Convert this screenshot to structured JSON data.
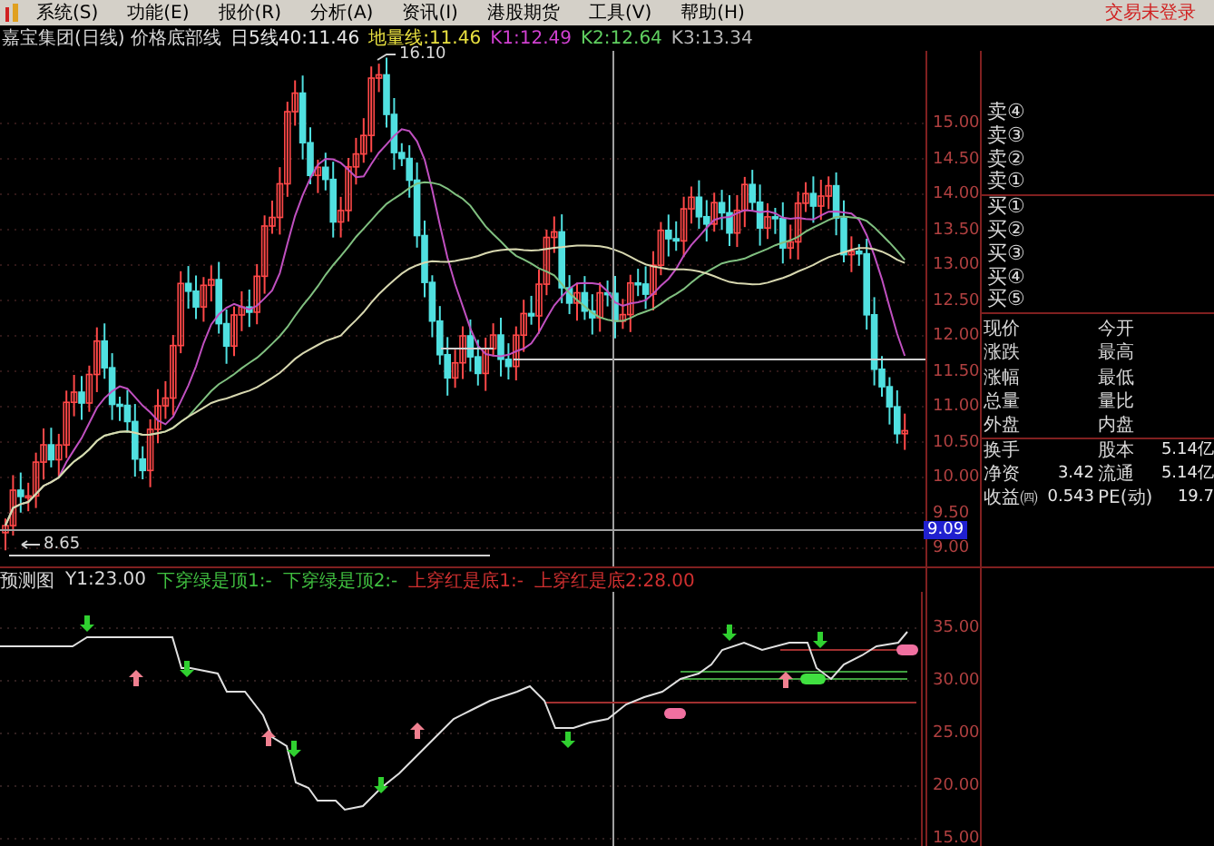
{
  "menu_bar": {
    "items": [
      "系统(S)",
      "功能(E)",
      "报价(R)",
      "分析(A)",
      "资讯(I)",
      "港股期货",
      "工具(V)",
      "帮助(H)"
    ],
    "login_status": "交易未登录"
  },
  "info_bar": [
    {
      "text": "嘉宝集团(日线) 价格底部线",
      "color": "#d8d8d8"
    },
    {
      "text": "日5线40:11.46",
      "color": "#e8e8e8"
    },
    {
      "text": "地量线:11.46",
      "color": "#e8e040"
    },
    {
      "text": "K1:12.49",
      "color": "#d040d0"
    },
    {
      "text": "K2:12.64",
      "color": "#60d060"
    },
    {
      "text": "K3:13.34",
      "color": "#b8b8b8"
    }
  ],
  "price_chart": {
    "high_label": "16.10",
    "low_label": "8.65",
    "axis_ticks": [
      "15.00",
      "14.50",
      "14.00",
      "13.50",
      "13.00",
      "12.50",
      "12.00",
      "11.50",
      "11.00",
      "10.50",
      "10.00",
      "9.50",
      "9.00"
    ],
    "cursor_price": "9.09"
  },
  "order_book": {
    "sell": [
      "卖④",
      "卖③",
      "卖②",
      "卖①"
    ],
    "buy": [
      "买①",
      "买②",
      "买③",
      "买④",
      "买⑤"
    ]
  },
  "quote_rows": [
    [
      {
        "label": "现价"
      },
      {
        "label": "今开"
      }
    ],
    [
      {
        "label": "涨跌"
      },
      {
        "label": "最高"
      }
    ],
    [
      {
        "label": "涨幅"
      },
      {
        "label": "最低"
      }
    ],
    [
      {
        "label": "总量"
      },
      {
        "label": "量比"
      }
    ],
    [
      {
        "label": "外盘"
      },
      {
        "label": "内盘"
      }
    ],
    [
      {
        "label": "换手"
      },
      {
        "label": "股本",
        "value": "5.14亿"
      }
    ],
    [
      {
        "label": "净资",
        "value": "3.42"
      },
      {
        "label": "流通",
        "value": "5.14亿"
      }
    ],
    [
      {
        "label": "收益㈣",
        "value": "0.543"
      },
      {
        "label": "PE(动)",
        "value": "19.7"
      }
    ]
  ],
  "indicator": {
    "title": "预测图",
    "fields": [
      {
        "text": "Y1:23.00",
        "color": "#d8d8d8"
      },
      {
        "text": "下穿绿是顶1:-",
        "color": "#40c040"
      },
      {
        "text": "下穿绿是顶2:-",
        "color": "#40c040"
      },
      {
        "text": "上穿红是底1:-",
        "color": "#d03030"
      },
      {
        "text": "上穿红是底2:28.00",
        "color": "#d03030"
      }
    ],
    "axis_ticks": [
      "35.00",
      "30.00",
      "25.00",
      "20.00",
      "15.00"
    ]
  }
}
